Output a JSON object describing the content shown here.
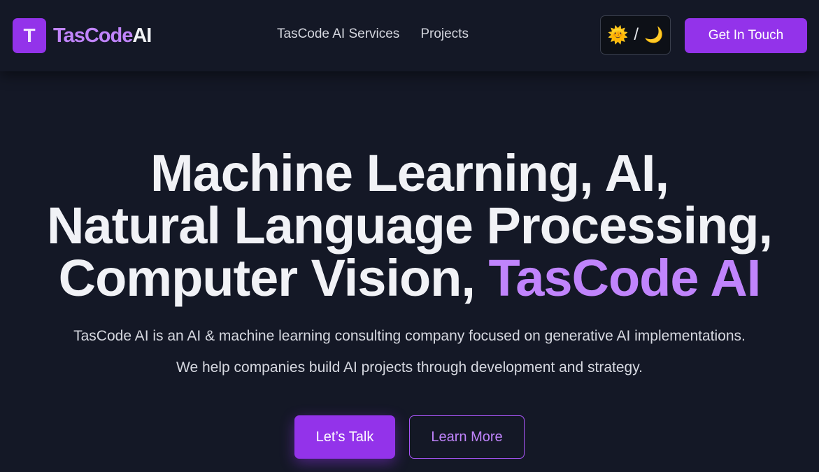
{
  "brand": {
    "logo_letter": "T",
    "name_part1": "TasCode",
    "name_part2": "AI"
  },
  "nav": {
    "items": [
      {
        "label": "TasCode AI Services"
      },
      {
        "label": "Projects"
      }
    ]
  },
  "theme_toggle": {
    "sun": "🌞",
    "separator": "/",
    "moon": "🌙"
  },
  "header_cta": {
    "label": "Get In Touch"
  },
  "hero": {
    "title_line1": "Machine Learning, AI,",
    "title_line2": "Natural Language Processing,",
    "title_line3": "Computer Vision, ",
    "title_accent": "TasCode AI",
    "paragraph1": "TasCode AI is an AI & machine learning consulting company focused on generative AI implementations.",
    "paragraph2": "We help companies build AI projects through development and strategy.",
    "primary_button": "Let’s Talk",
    "secondary_button": "Learn More"
  },
  "colors": {
    "background": "#141826",
    "accent": "#9333ea",
    "accent_text": "#c084fc"
  }
}
